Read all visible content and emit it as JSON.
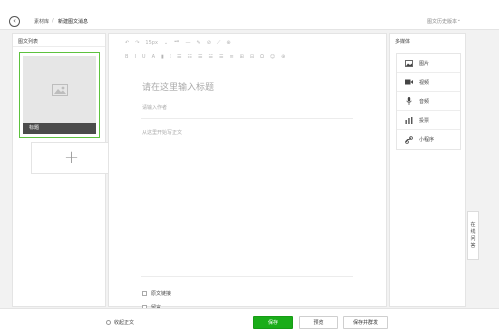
{
  "breadcrumb": {
    "home": "素材库",
    "separator": "/",
    "current": "新建图文消息"
  },
  "history_label": "图文历史版本",
  "left_panel": {
    "title": "图文列表",
    "article": {
      "caption": "标题"
    },
    "add_symbol": "+"
  },
  "toolbar": {
    "row1": [
      "↶",
      "↷",
      "15px",
      "⌄",
      "❝❞",
      "—",
      "✎",
      "⊘",
      "⟋",
      "⊕"
    ],
    "row2": [
      "B",
      "I",
      "U",
      "A",
      "▮",
      "⫶",
      "☰",
      "☷",
      "☰",
      "☱",
      "☰",
      "≡",
      "⊞",
      "⊟",
      "Ω",
      "☺",
      "⊕"
    ]
  },
  "editor": {
    "title_placeholder": "请在这里输入标题",
    "author_placeholder": "请输入作者",
    "content_placeholder": "从这里开始写正文",
    "options": [
      {
        "label": "原文链接",
        "checked": false
      },
      {
        "label": "留言",
        "checked": false
      }
    ]
  },
  "right_panel": {
    "title": "多媒体",
    "items": [
      {
        "label": "图片",
        "icon": "image-icon"
      },
      {
        "label": "视频",
        "icon": "video-icon"
      },
      {
        "label": "音频",
        "icon": "microphone-icon"
      },
      {
        "label": "投票",
        "icon": "poll-icon"
      },
      {
        "label": "小程序",
        "icon": "miniprogram-icon"
      }
    ]
  },
  "side_tab": [
    "在",
    "线",
    "问",
    "答"
  ],
  "bottom": {
    "collapse_label": "收起正文",
    "save": "保存",
    "preview": "预览",
    "publish": "保存并群发"
  },
  "colors": {
    "primary": "#1aad19",
    "selected_border": "#5dc23e"
  }
}
